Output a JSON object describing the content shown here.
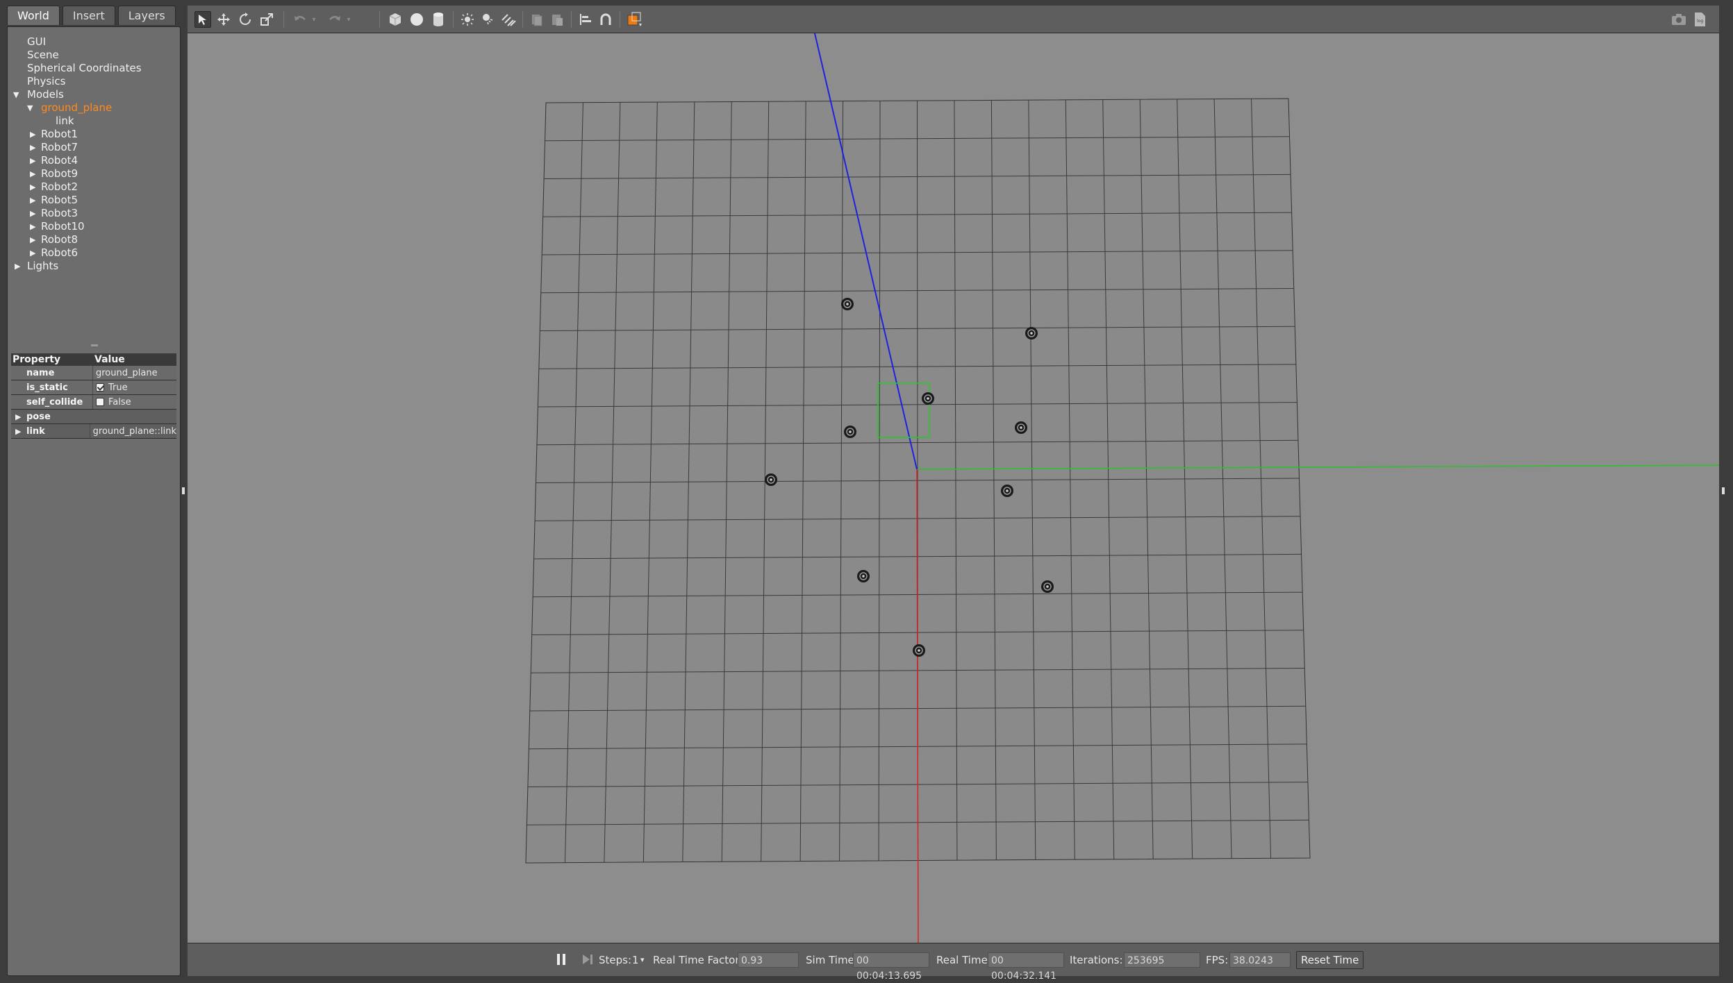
{
  "tabs": [
    "World",
    "Insert",
    "Layers"
  ],
  "tree": {
    "top_items": [
      "GUI",
      "Scene",
      "Spherical Coordinates",
      "Physics"
    ],
    "models_label": "Models",
    "selected_model": "ground_plane",
    "selected_child": "link",
    "robots": [
      "Robot1",
      "Robot7",
      "Robot4",
      "Robot9",
      "Robot2",
      "Robot5",
      "Robot3",
      "Robot10",
      "Robot8",
      "Robot6"
    ],
    "lights_label": "Lights"
  },
  "properties": {
    "header_property": "Property",
    "header_value": "Value",
    "name_key": "name",
    "name_value": "ground_plane",
    "is_static_key": "is_static",
    "is_static_value": "True",
    "self_collide_key": "self_collide",
    "self_collide_value": "False",
    "pose_key": "pose",
    "link_key": "link",
    "link_value": "ground_plane::link"
  },
  "bottom_bar": {
    "steps_label": "Steps:",
    "steps_value": "1",
    "rtf_label": "Real Time Factor:",
    "rtf_value": "0.93",
    "sim_time_label": "Sim Time:",
    "sim_time_value": "00 00:04:13.695",
    "real_time_label": "Real Time:",
    "real_time_value": "00 00:04:32.141",
    "iterations_label": "Iterations:",
    "iterations_value": "253695",
    "fps_label": "FPS:",
    "fps_value": "38.0243",
    "reset_label": "Reset Time"
  },
  "icons": {
    "toolbar": [
      "select-arrow-icon",
      "translate-icon",
      "rotate-icon",
      "scale-icon",
      "undo-icon",
      "redo-icon",
      "box-icon",
      "sphere-icon",
      "cylinder-icon",
      "point-light-icon",
      "spot-light-icon",
      "directional-light-icon",
      "copy-icon",
      "paste-icon",
      "align-icon",
      "snap-icon",
      "view-angle-icon",
      "screenshot-icon",
      "log-icon"
    ]
  },
  "colors": {
    "selected": "#ff8a1e",
    "axis_x": "#e02020",
    "axis_y": "#20c020",
    "axis_z": "#2020e0",
    "selection_box": "#22cc22"
  }
}
